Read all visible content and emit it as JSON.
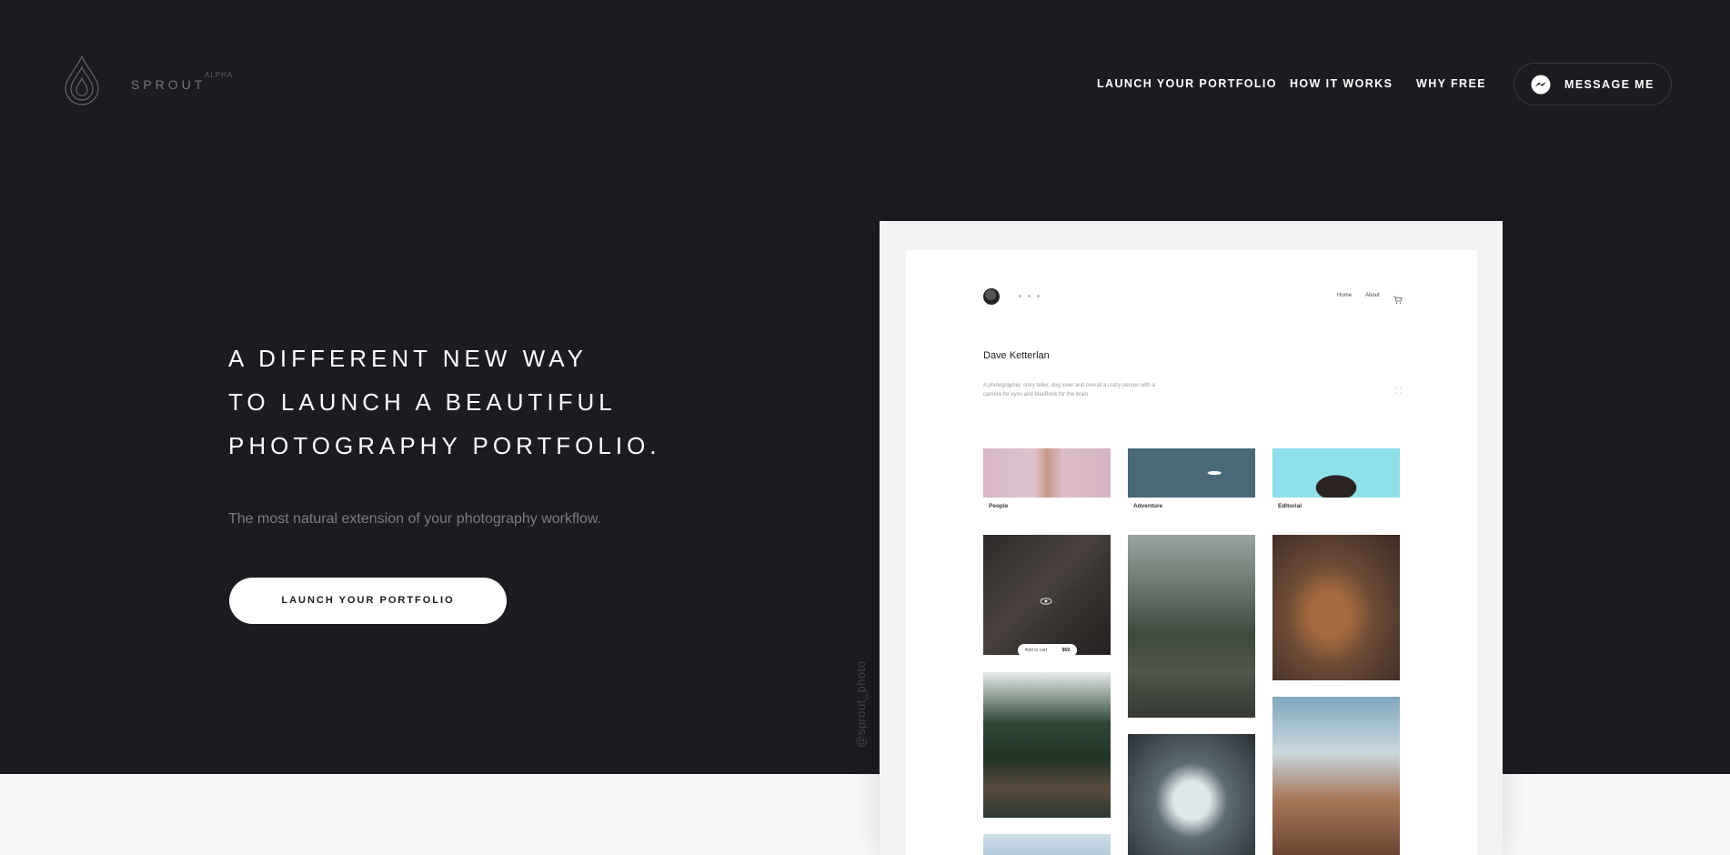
{
  "brand": {
    "name": "SPROUT",
    "tag": "ALPHA"
  },
  "nav": {
    "items": [
      "LAUNCH YOUR PORTFOLIO",
      "HOW IT WORKS",
      "WHY FREE"
    ],
    "message_label": "MESSAGE ME",
    "message_icon": "messenger-icon"
  },
  "hero": {
    "lines": [
      "A DIFFERENT NEW WAY",
      "TO LAUNCH A BEAUTIFUL",
      "PHOTOGRAPHY PORTFOLIO."
    ],
    "subtitle": "The most natural extension of your photography workflow.",
    "cta_label": "LAUNCH YOUR PORTFOLIO"
  },
  "handle": "@sprout_photo",
  "mockup": {
    "nav": [
      "Home",
      "About"
    ],
    "cart_icon": "cart-icon",
    "name": "Dave Ketterlan",
    "bio": "A photographer, story teller, dog lover and overall a crazy person with a camera for eyes and MacBook for the brain.",
    "categories": [
      "People",
      "Adventure",
      "Editorial"
    ],
    "add_to_cart": "Add to cart",
    "price": "$59"
  },
  "colors": {
    "background": "#1c1b21",
    "text": "#ffffff",
    "muted": "#7c7b82",
    "light_band": "#f9f9fa"
  }
}
